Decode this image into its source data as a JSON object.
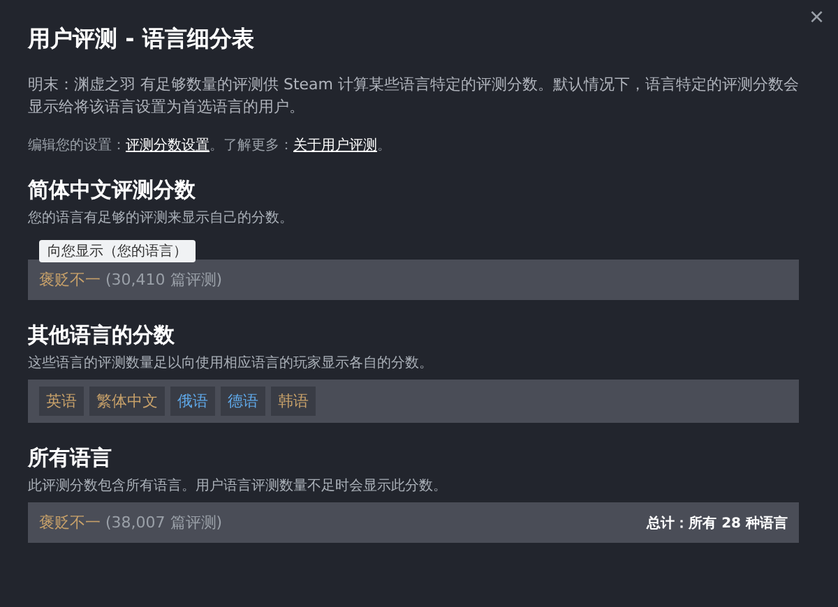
{
  "dialog": {
    "title": "用户评测 - 语言细分表",
    "close": "×",
    "description": "明末：渊虚之羽 有足够数量的评测供 Steam 计算某些语言特定的评测分数。默认情况下，语言特定的评测分数会显示给将该语言设置为首选语言的用户。",
    "settings_line": [
      {
        "kind": "text",
        "text": "编辑您的设置："
      },
      {
        "kind": "link",
        "text": "评测分数设置"
      },
      {
        "kind": "text",
        "text": "。了解更多："
      },
      {
        "kind": "link",
        "text": "关于用户评测"
      },
      {
        "kind": "text",
        "text": "。"
      }
    ]
  },
  "sections": [
    {
      "kind": "score",
      "title": "简体中文评测分数",
      "subtitle": "您的语言有足够的评测来显示自己的分数。",
      "tag": "向您显示（您的语言）",
      "rating": "褒贬不一",
      "count": "(30,410 篇评测)"
    },
    {
      "kind": "languages",
      "title": "其他语言的分数",
      "subtitle": "这些语言的评测数量足以向使用相应语言的玩家显示各自的分数。",
      "languages": [
        {
          "label": "英语",
          "color": "#c9a26a"
        },
        {
          "label": "繁体中文",
          "color": "#c9a26a"
        },
        {
          "label": "俄语",
          "color": "#5fa8e8"
        },
        {
          "label": "德语",
          "color": "#5fa8e8"
        },
        {
          "label": "韩语",
          "color": "#c9a26a"
        }
      ]
    },
    {
      "kind": "score",
      "title": "所有语言",
      "subtitle": "此评测分数包含所有语言。用户语言评测数量不足时会显示此分数。",
      "rating": "褒贬不一",
      "count": "(38,007 篇评测)",
      "total": "总计：所有 28 种语言"
    }
  ]
}
